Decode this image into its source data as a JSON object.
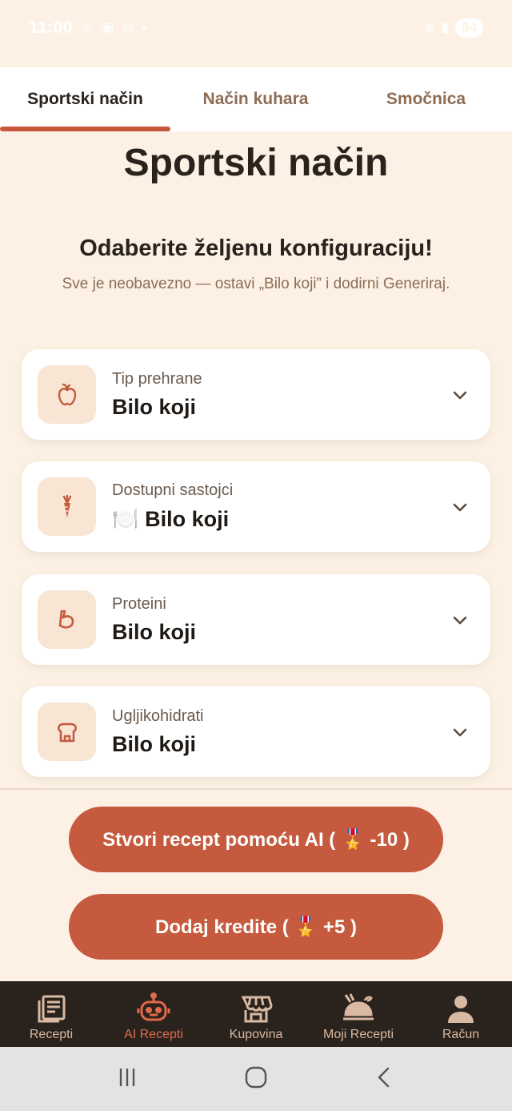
{
  "status_bar": {
    "time": "11:00",
    "battery": "94"
  },
  "tabs": [
    {
      "label": "Sportski način",
      "active": true
    },
    {
      "label": "Način kuhara",
      "active": false
    },
    {
      "label": "Smočnica",
      "active": false
    }
  ],
  "main": {
    "title": "Sportski način",
    "subtitle": "Odaberite željenu konfiguraciju!",
    "hint": "Sve je neobavezno — ostavi „Bilo koji” i dodirni Generiraj."
  },
  "config_cards": [
    {
      "label": "Tip prehrane",
      "value": "Bilo koji",
      "icon": "apple-icon"
    },
    {
      "label": "Dostupni sastojci",
      "value": "Bilo koji",
      "prefix_emoji": "🍽️",
      "icon": "carrot-icon"
    },
    {
      "label": "Proteini",
      "value": "Bilo koji",
      "icon": "muscle-icon"
    },
    {
      "label": "Ugljikohidrati",
      "value": "Bilo koji",
      "icon": "bread-icon"
    }
  ],
  "buttons": {
    "generate": "Stvori recept pomoću AI ( 🎖️ -10 )",
    "add_credits": "Dodaj kredite ( 🎖️ +5 )"
  },
  "bottom_nav": [
    {
      "label": "Recepti",
      "icon": "recipes-icon",
      "active": false
    },
    {
      "label": "AI Recepti",
      "icon": "robot-icon",
      "active": true
    },
    {
      "label": "Kupovina",
      "icon": "store-icon",
      "active": false
    },
    {
      "label": "Moji Recepti",
      "icon": "dish-icon",
      "active": false
    },
    {
      "label": "Račun",
      "icon": "account-icon",
      "active": false
    }
  ],
  "colors": {
    "accent": "#c55a3e",
    "background": "#fcf1e4",
    "nav_bg": "#2a221d",
    "icon_box": "#f8e5d4"
  }
}
